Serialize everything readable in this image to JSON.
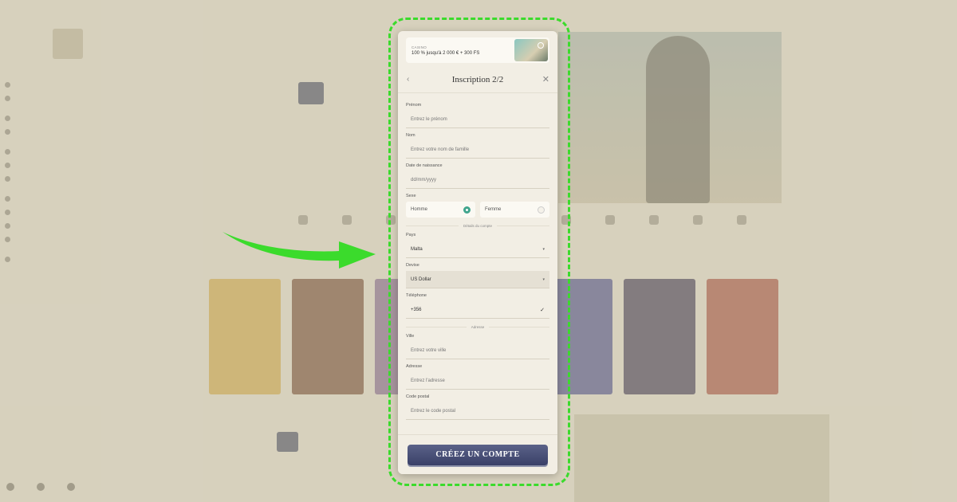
{
  "colors": {
    "accent": "#3bdb2c",
    "button": "#3a4068",
    "radio_on": "#40a58d"
  },
  "modal": {
    "banner": {
      "label": "CASINO",
      "text": "100 % jusqu'à 2 000 € + 300 FS"
    },
    "title": "Inscription 2/2",
    "back_icon": "chevron-left-icon",
    "close_icon": "close-icon",
    "fields": {
      "prenom": {
        "label": "Prénom",
        "placeholder": "Entrez le prénom"
      },
      "nom": {
        "label": "Nom",
        "placeholder": "Entrez votre nom de famille"
      },
      "dob": {
        "label": "Date de naissance",
        "placeholder": "dd/mm/yyyy"
      },
      "sexe": {
        "label": "Sexe",
        "options": [
          "Homme",
          "Femme"
        ],
        "selected": "Homme"
      },
      "section_account": "Détails du compte",
      "pays": {
        "label": "Pays",
        "value": "Malta"
      },
      "devise": {
        "label": "Devise",
        "value": "US Dollar"
      },
      "telephone": {
        "label": "Téléphone",
        "value": "+356"
      },
      "section_address": "Adresse",
      "ville": {
        "label": "Ville",
        "placeholder": "Entrez votre ville"
      },
      "adresse": {
        "label": "Adresse",
        "placeholder": "Entrez l'adresse"
      },
      "code_postal": {
        "label": "Code postal",
        "placeholder": "Entrez le code postal"
      }
    },
    "submit_label": "CRÉEZ UN COMPTE"
  }
}
